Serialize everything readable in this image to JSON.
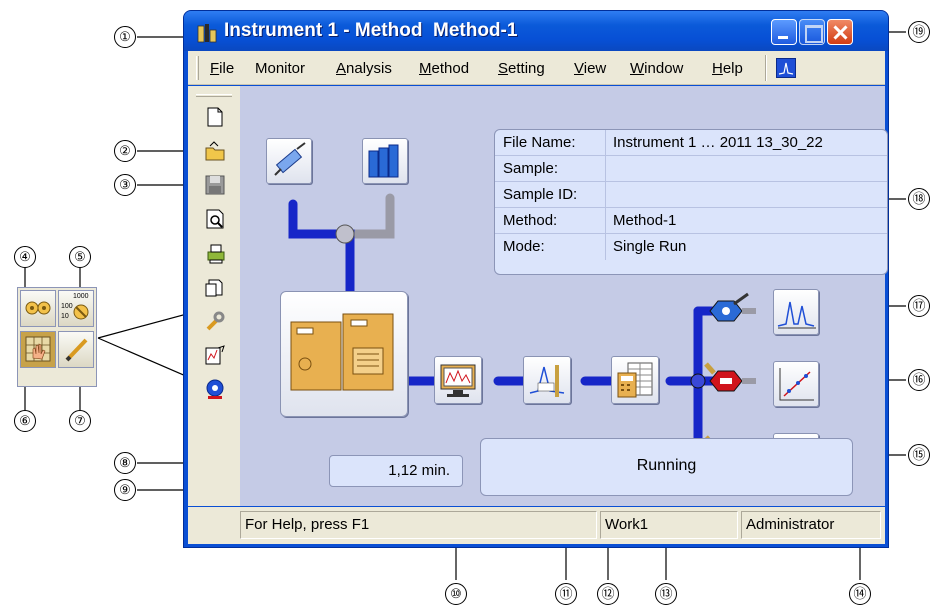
{
  "window": {
    "title": "Instrument 1 - Method  Method-1"
  },
  "menu": {
    "items": [
      {
        "label": "File",
        "accel": "F",
        "rest": "ile"
      },
      {
        "label": "Monitor",
        "accel": "",
        "rest": "Monitor"
      },
      {
        "label": "Analysis",
        "accel": "A",
        "rest": "nalysis"
      },
      {
        "label": "Method",
        "accel": "M",
        "rest": "ethod"
      },
      {
        "label": "Setting",
        "accel": "S",
        "rest": "etting"
      },
      {
        "label": "View",
        "accel": "V",
        "rest": "iew"
      },
      {
        "label": "Window",
        "accel": "W",
        "rest": "indow"
      },
      {
        "label": "Help",
        "accel": "H",
        "rest": "elp"
      }
    ]
  },
  "info": {
    "rows": [
      {
        "key": "File Name:",
        "value": "Instrument 1  … 2011 13_30_22"
      },
      {
        "key": "Sample:",
        "value": ""
      },
      {
        "key": "Sample ID:",
        "value": ""
      },
      {
        "key": "Method:",
        "value": "Method-1"
      },
      {
        "key": "Mode:",
        "value": "Single Run"
      }
    ]
  },
  "run": {
    "time": "1,12 min.",
    "status": "Running"
  },
  "statusbar": {
    "help": "For Help, press F1",
    "workspace": "Work1",
    "user": "Administrator"
  },
  "toolbox": {
    "scale_top": "1000",
    "scale_mid": "100",
    "scale_bot": "10"
  },
  "callouts": [
    "①",
    "②",
    "③",
    "④",
    "⑤",
    "⑥",
    "⑦",
    "⑧",
    "⑨",
    "⑩",
    "⑪",
    "⑫",
    "⑬",
    "⑭",
    "⑮",
    "⑯",
    "⑰",
    "⑱",
    "⑲"
  ],
  "colors": {
    "title_blue": "#0750d6",
    "pipe_blue": "#1626c8",
    "pipe_grey": "#9a9aa6",
    "valve_red": "#d0141c",
    "workspace": "#c5cbe6"
  }
}
